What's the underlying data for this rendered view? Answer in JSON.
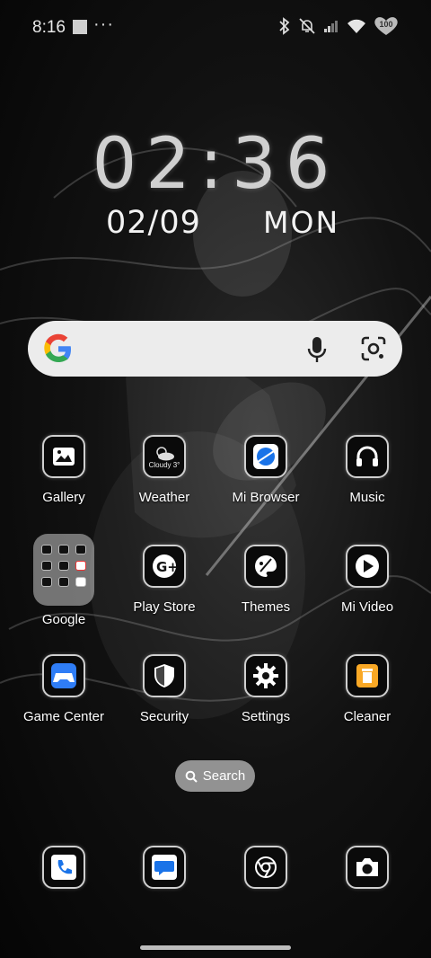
{
  "status_bar": {
    "time": "8:16",
    "dots": "···",
    "battery": "100"
  },
  "lock_widget": {
    "clock": "02:36",
    "date": "02/09",
    "day": "MON"
  },
  "apps": {
    "row1": [
      {
        "label": "Gallery",
        "icon": "gallery-icon"
      },
      {
        "label": "Weather",
        "icon": "weather-icon",
        "sub": "Cloudy 3°"
      },
      {
        "label": "Mi Browser",
        "icon": "browser-icon"
      },
      {
        "label": "Music",
        "icon": "headphones-icon"
      }
    ],
    "row2": [
      {
        "label": "Google",
        "icon": "folder-icon"
      },
      {
        "label": "Play Store",
        "icon": "play-store-icon"
      },
      {
        "label": "Themes",
        "icon": "palette-icon"
      },
      {
        "label": "Mi Video",
        "icon": "play-circle-icon"
      }
    ],
    "row3": [
      {
        "label": "Game Center",
        "icon": "gamepad-icon"
      },
      {
        "label": "Security",
        "icon": "shield-icon"
      },
      {
        "label": "Settings",
        "icon": "gear-icon"
      },
      {
        "label": "Cleaner",
        "icon": "trash-icon"
      }
    ]
  },
  "search_pill": {
    "label": "Search"
  },
  "dock": [
    "phone-icon",
    "messages-icon",
    "chrome-icon",
    "camera-icon"
  ],
  "colors": {
    "accent_blue": "#1a73e8",
    "cleaner_yellow": "#f9a825",
    "game_blue": "#2f7df6"
  }
}
